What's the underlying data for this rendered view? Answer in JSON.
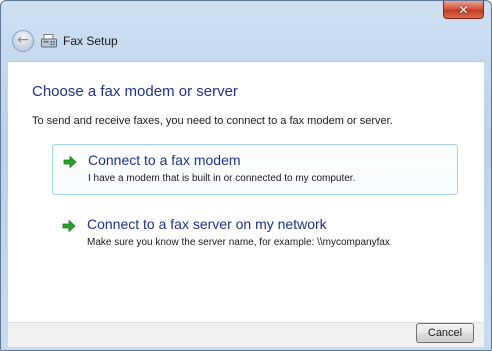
{
  "window": {
    "title": "Fax Setup",
    "close_label": "✕"
  },
  "content": {
    "heading": "Choose a fax modem or server",
    "instruction": "To send and receive faxes, you need to connect to a fax modem or server.",
    "options": [
      {
        "title": "Connect to a fax modem",
        "description": "I have a modem that is built in or connected to my computer.",
        "selected": true
      },
      {
        "title": "Connect to a fax server on my network",
        "description": "Make sure you know the server name, for example: \\\\mycompanyfax",
        "selected": false
      }
    ]
  },
  "footer": {
    "cancel_label": "Cancel"
  },
  "icons": {
    "back": "back-arrow-icon",
    "fax": "fax-icon",
    "option_arrow": "green-arrow-icon"
  },
  "colors": {
    "heading": "#1e3287",
    "option_arrow": "#2aa12a",
    "selected_border": "#a6d5ec",
    "close_button": "#c8452b"
  }
}
